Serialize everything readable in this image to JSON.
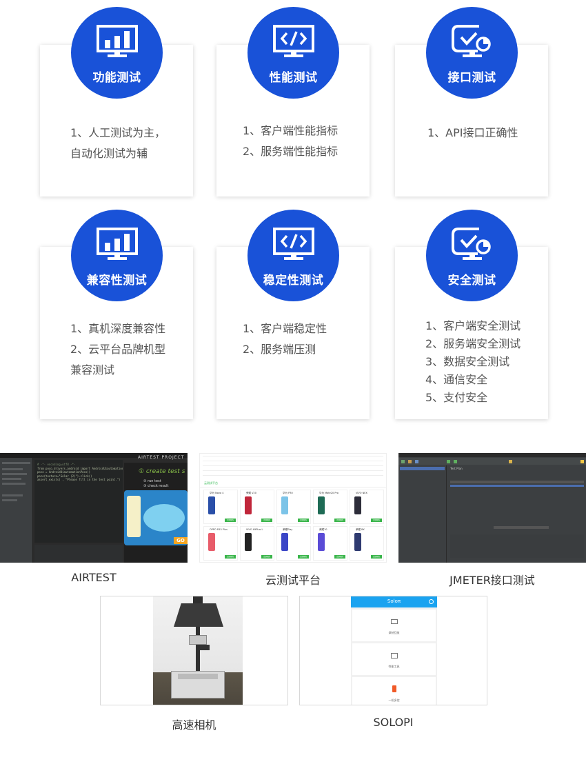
{
  "cards": [
    {
      "title": "功能测试",
      "icon": "bar-chart-monitor-icon",
      "lines": [
        "1、人工测试为主，",
        "自动化测试为辅"
      ]
    },
    {
      "title": "性能测试",
      "icon": "code-monitor-icon",
      "lines": [
        "1、客户端性能指标",
        "2、服务端性能指标"
      ]
    },
    {
      "title": "接口测试",
      "icon": "check-monitor-icon",
      "lines": [
        "1、API接口正确性"
      ]
    },
    {
      "title": "兼容性测试",
      "icon": "bar-chart-monitor-icon",
      "lines": [
        "1、真机深度兼容性",
        "2、云平台品牌机型",
        "兼容测试"
      ]
    },
    {
      "title": "稳定性测试",
      "icon": "code-monitor-icon",
      "lines": [
        "1、客户端稳定性",
        "2、服务端压测"
      ]
    },
    {
      "title": "安全测试",
      "icon": "check-monitor-icon",
      "lines": [
        "1、客户端安全测试",
        "2、服务端安全测试",
        "3、数据安全测试",
        "4、通信安全",
        "5、支付安全"
      ]
    }
  ],
  "tools": [
    {
      "caption": "AIRTEST"
    },
    {
      "caption": "云测试平台"
    },
    {
      "caption": "JMETER接口测试"
    },
    {
      "caption": "高速相机"
    },
    {
      "caption": "SOLOPI"
    }
  ],
  "airtest": {
    "project_label": "AIRTEST PROJECT",
    "code_lines": [
      "# -*- encoding=utf8 -*-",
      "from poco.drivers.android import AndroidUiautomationPoco",
      "poco = AndroidUiautomationPoco()",
      "",
      "poco(texture=\"Solar (2)\").click()",
      "",
      "",
      "assert_exists(       , \"Please fill in the test point.\")"
    ],
    "step1": "① create test s",
    "step2": "② run test",
    "step3": "③ check result",
    "go": "GO"
  },
  "cloud": {
    "tab": "云测试平台",
    "phones": [
      "华为 Nova 4",
      "荣耀 V20",
      "华为 P30",
      "华为 Mate20 Pro",
      "VIVO NEX",
      "OPPO R15 Plus",
      "VIVO X9Plus L",
      "荣耀Play",
      "荣耀10",
      "荣耀 8X"
    ],
    "btn": "立即预约"
  },
  "jmeter": {
    "title": "Test Plan"
  },
  "solopi": {
    "title": "Soloπ",
    "items": [
      "录制回放",
      "性能工具",
      "一机多控"
    ]
  }
}
